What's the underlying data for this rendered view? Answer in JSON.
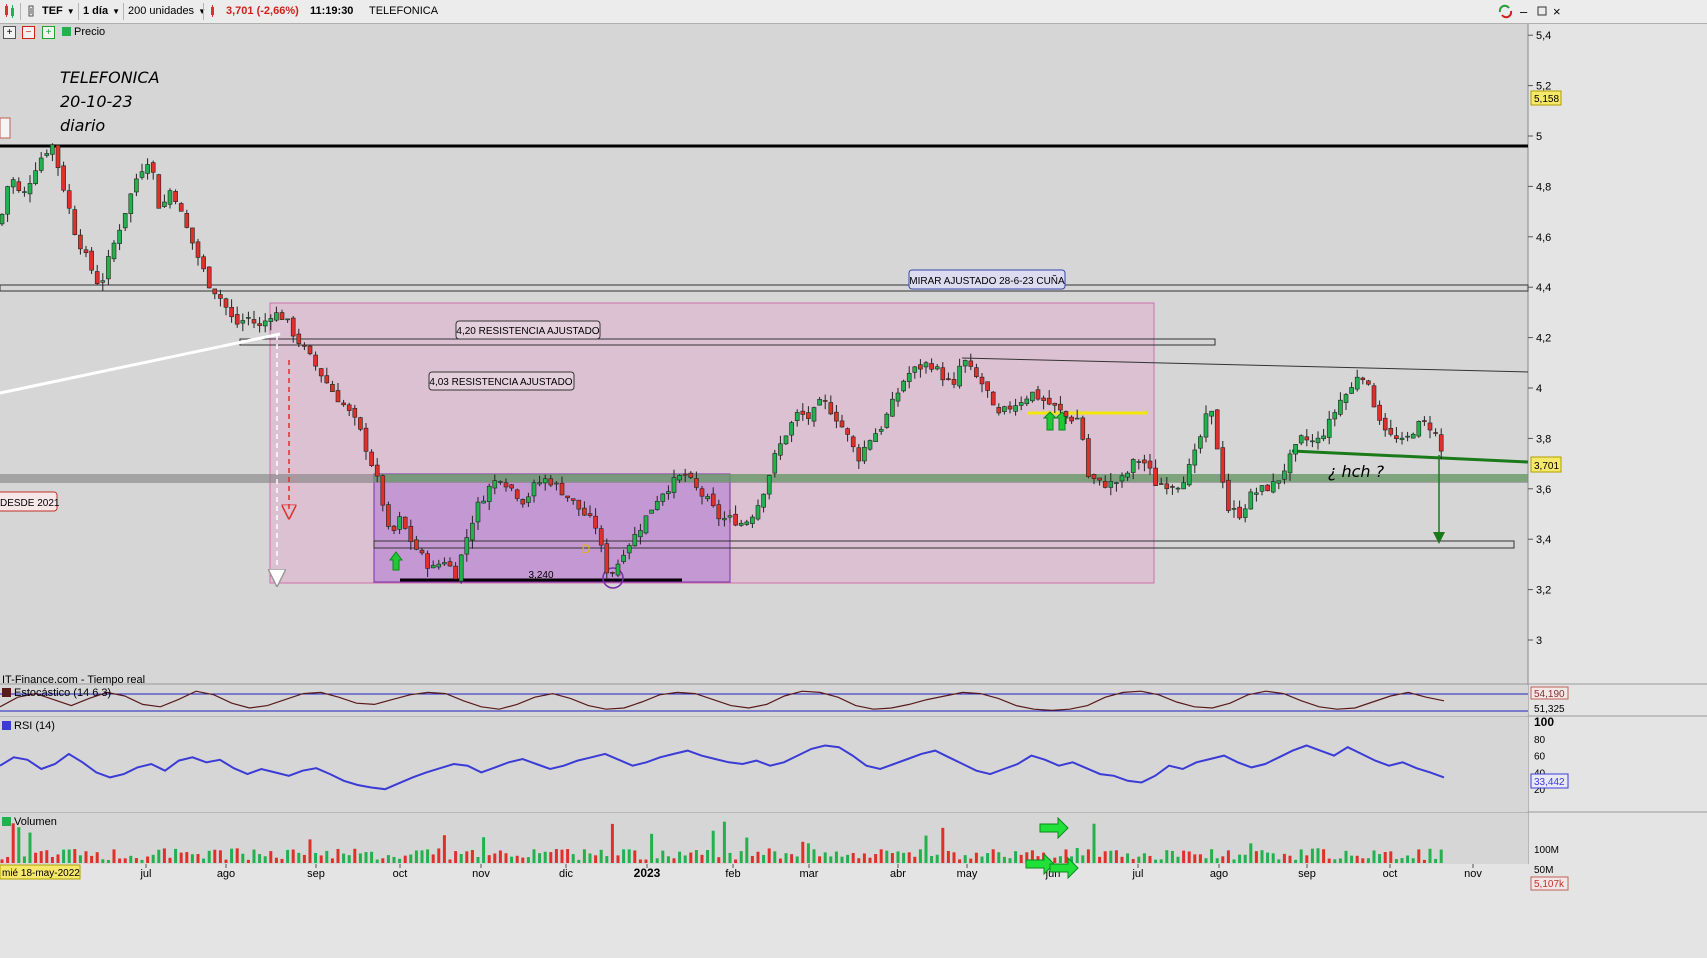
{
  "toolbar": {
    "symbol": "TEF",
    "timeframe": "1 día",
    "units": "200 unidades",
    "price_change": "3,701 (-2,66%)",
    "time": "11:19:30",
    "name": "TELEFONICA"
  },
  "subbar": {
    "series_label": "Precio"
  },
  "annotations": {
    "title": "TELEFONICA",
    "date": "20-10-23",
    "period": "diario",
    "label_mirar": "MIRAR AJUSTADO 28-6-23 CUÑA",
    "label_420": "4,20 RESISTENCIA AJUSTADO",
    "label_403": "4,03 RESISTENCIA AJUSTADO",
    "label_desde": "DESDE 2021",
    "label_low": "3,240",
    "label_d": "D",
    "label_hch": "¿ hch ?"
  },
  "panels": {
    "source": "IT-Finance.com - Tiempo real",
    "stoch_label": "Estocástico (14 6 3)",
    "rsi_label": "RSI (14)",
    "volume_label": "Volumen"
  },
  "colors": {
    "up": "#22b14c",
    "down": "#e0302a",
    "rsi": "#3b3bd6",
    "box_pink": "#e8a6cf",
    "box_purple": "#b077d4",
    "zone_green": "#5aa55a",
    "trend_green": "#1a7a1a",
    "yellow": "#f5e60a"
  },
  "price_labels": {
    "high": "5,158",
    "last": "3,701"
  },
  "stoch_values": {
    "upper": "54,190",
    "lower": "51,325"
  },
  "rsi_value": "33,442",
  "volume_value": "5,107k",
  "date_tag": "mié 18-may-2022",
  "chart_data": {
    "type": "candlestick",
    "title": "TELEFONICA",
    "y_axis": {
      "range": [
        2.85,
        5.45
      ],
      "ticks": [
        "5,4",
        "5,2",
        "5",
        "4,8",
        "4,6",
        "4,4",
        "4,2",
        "4",
        "3,8",
        "3,6",
        "3,4",
        "3,2",
        "3"
      ]
    },
    "x_axis": {
      "ticks": [
        "jul",
        "ago",
        "sep",
        "oct",
        "nov",
        "dic",
        "2023",
        "feb",
        "mar",
        "abr",
        "may",
        "jun",
        "jul",
        "ago",
        "sep",
        "oct",
        "nov"
      ]
    },
    "close_path": [
      [
        0,
        4.65
      ],
      [
        10,
        4.85
      ],
      [
        22,
        4.75
      ],
      [
        38,
        4.9
      ],
      [
        52,
        4.97
      ],
      [
        62,
        4.82
      ],
      [
        75,
        4.62
      ],
      [
        88,
        4.5
      ],
      [
        100,
        4.4
      ],
      [
        112,
        4.55
      ],
      [
        125,
        4.7
      ],
      [
        138,
        4.85
      ],
      [
        150,
        4.92
      ],
      [
        160,
        4.7
      ],
      [
        172,
        4.8
      ],
      [
        182,
        4.68
      ],
      [
        195,
        4.55
      ],
      [
        208,
        4.42
      ],
      [
        222,
        4.35
      ],
      [
        235,
        4.25
      ],
      [
        248,
        4.28
      ],
      [
        260,
        4.24
      ],
      [
        272,
        4.3
      ],
      [
        284,
        4.28
      ],
      [
        296,
        4.2
      ],
      [
        310,
        4.12
      ],
      [
        322,
        4.05
      ],
      [
        334,
        3.98
      ],
      [
        346,
        3.92
      ],
      [
        358,
        3.85
      ],
      [
        370,
        3.72
      ],
      [
        380,
        3.6
      ],
      [
        390,
        3.4
      ],
      [
        400,
        3.48
      ],
      [
        410,
        3.4
      ],
      [
        420,
        3.34
      ],
      [
        432,
        3.28
      ],
      [
        444,
        3.32
      ],
      [
        456,
        3.26
      ],
      [
        466,
        3.4
      ],
      [
        476,
        3.52
      ],
      [
        488,
        3.6
      ],
      [
        500,
        3.65
      ],
      [
        512,
        3.6
      ],
      [
        524,
        3.55
      ],
      [
        536,
        3.62
      ],
      [
        548,
        3.64
      ],
      [
        560,
        3.6
      ],
      [
        572,
        3.55
      ],
      [
        584,
        3.5
      ],
      [
        596,
        3.45
      ],
      [
        606,
        3.28
      ],
      [
        614,
        3.27
      ],
      [
        624,
        3.36
      ],
      [
        636,
        3.42
      ],
      [
        648,
        3.5
      ],
      [
        660,
        3.58
      ],
      [
        672,
        3.62
      ],
      [
        684,
        3.66
      ],
      [
        696,
        3.6
      ],
      [
        708,
        3.55
      ],
      [
        720,
        3.48
      ],
      [
        732,
        3.48
      ],
      [
        744,
        3.46
      ],
      [
        756,
        3.52
      ],
      [
        766,
        3.62
      ],
      [
        774,
        3.72
      ],
      [
        786,
        3.82
      ],
      [
        798,
        3.9
      ],
      [
        810,
        3.88
      ],
      [
        822,
        3.95
      ],
      [
        834,
        3.9
      ],
      [
        846,
        3.82
      ],
      [
        858,
        3.72
      ],
      [
        870,
        3.8
      ],
      [
        882,
        3.85
      ],
      [
        894,
        3.95
      ],
      [
        906,
        4.05
      ],
      [
        918,
        4.08
      ],
      [
        930,
        4.1
      ],
      [
        942,
        4.05
      ],
      [
        954,
        4.0
      ],
      [
        962,
        4.12
      ],
      [
        974,
        4.05
      ],
      [
        986,
        4.0
      ],
      [
        996,
        3.88
      ],
      [
        1008,
        3.92
      ],
      [
        1020,
        3.95
      ],
      [
        1032,
        3.98
      ],
      [
        1044,
        3.95
      ],
      [
        1056,
        3.92
      ],
      [
        1068,
        3.88
      ],
      [
        1080,
        3.88
      ],
      [
        1088,
        3.65
      ],
      [
        1100,
        3.62
      ],
      [
        1112,
        3.62
      ],
      [
        1124,
        3.64
      ],
      [
        1136,
        3.72
      ],
      [
        1146,
        3.7
      ],
      [
        1156,
        3.62
      ],
      [
        1168,
        3.62
      ],
      [
        1180,
        3.62
      ],
      [
        1192,
        3.7
      ],
      [
        1200,
        3.8
      ],
      [
        1210,
        3.93
      ],
      [
        1218,
        3.75
      ],
      [
        1228,
        3.52
      ],
      [
        1240,
        3.5
      ],
      [
        1252,
        3.58
      ],
      [
        1264,
        3.6
      ],
      [
        1276,
        3.62
      ],
      [
        1290,
        3.72
      ],
      [
        1302,
        3.8
      ],
      [
        1316,
        3.78
      ],
      [
        1328,
        3.85
      ],
      [
        1340,
        3.95
      ],
      [
        1352,
        4.0
      ],
      [
        1360,
        4.08
      ],
      [
        1370,
        3.98
      ],
      [
        1380,
        3.88
      ],
      [
        1392,
        3.8
      ],
      [
        1404,
        3.78
      ],
      [
        1416,
        3.85
      ],
      [
        1428,
        3.86
      ],
      [
        1438,
        3.8
      ],
      [
        1444,
        3.7
      ]
    ],
    "levels": [
      {
        "value": 4.97,
        "label": ""
      },
      {
        "value": 4.41,
        "label": ""
      },
      {
        "value": 4.19,
        "label": "4,20 RESISTENCIA AJUSTADO"
      },
      {
        "value": 3.665,
        "label": ""
      },
      {
        "value": 3.38,
        "label": ""
      },
      {
        "value": 3.24,
        "label": "3,240"
      }
    ],
    "stochastic": {
      "upper": 54.19,
      "lower": 51.325,
      "values": [
        30,
        70,
        85,
        60,
        35,
        65,
        90,
        75,
        40,
        30,
        60,
        95,
        80,
        45,
        25,
        35,
        60,
        85,
        90,
        70,
        45,
        40,
        60,
        80,
        90,
        85,
        55,
        30,
        20,
        40,
        70,
        85,
        65,
        35,
        20,
        25,
        50,
        80,
        90,
        85,
        60,
        35,
        25,
        40,
        75,
        95,
        90,
        70,
        35,
        20,
        25,
        40,
        60,
        75,
        90,
        85,
        65,
        35,
        20,
        15,
        20,
        35,
        70,
        90,
        95,
        80,
        50,
        30,
        25,
        45,
        80,
        95,
        85,
        55,
        30,
        20,
        25,
        50,
        75,
        90,
        70,
        55
      ]
    },
    "rsi": {
      "value": 33.442,
      "ticks": [
        "100",
        "80",
        "60",
        "40",
        "20"
      ],
      "values": [
        48,
        58,
        55,
        44,
        50,
        62,
        52,
        40,
        34,
        38,
        46,
        50,
        42,
        54,
        58,
        52,
        55,
        45,
        38,
        44,
        40,
        36,
        42,
        45,
        38,
        30,
        25,
        22,
        20,
        27,
        34,
        40,
        45,
        50,
        48,
        40,
        46,
        52,
        56,
        50,
        44,
        48,
        54,
        58,
        62,
        55,
        48,
        52,
        58,
        62,
        66,
        60,
        56,
        52,
        50,
        54,
        48,
        52,
        60,
        68,
        72,
        70,
        60,
        48,
        44,
        50,
        56,
        62,
        66,
        58,
        50,
        42,
        38,
        44,
        50,
        60,
        55,
        48,
        52,
        45,
        38,
        36,
        30,
        28,
        36,
        48,
        44,
        52,
        56,
        60,
        52,
        46,
        50,
        58,
        66,
        72,
        66,
        60,
        70,
        62,
        54,
        48,
        52,
        45,
        40,
        34
      ]
    }
  }
}
